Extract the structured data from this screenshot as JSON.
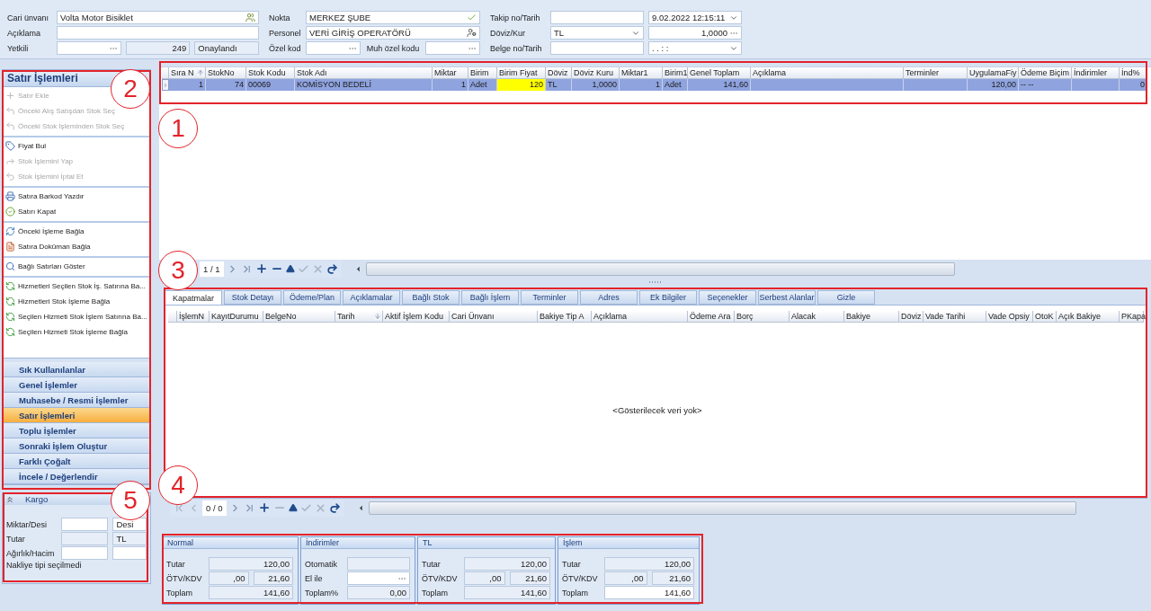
{
  "header": {
    "columns": [
      {
        "rows": [
          {
            "label": "Cari ünvanı",
            "fields": [
              {
                "kind": "people",
                "value": "Volta Motor Bisiklet",
                "editable": true
              }
            ]
          },
          {
            "label": "Açıklama",
            "fields": [
              {
                "editable": true
              }
            ]
          },
          {
            "label": "Yetkili",
            "fields": [
              {
                "kind": "lookup",
                "editable": true
              },
              {
                "kind": "number",
                "value": "249",
                "editable": false
              },
              {
                "value": "Onaylandı",
                "editable": false
              }
            ]
          }
        ]
      },
      {
        "rows": [
          {
            "label": "Nokta",
            "fields": [
              {
                "kind": "check",
                "value": "MERKEZ ŞUBE",
                "editable": true
              }
            ]
          },
          {
            "label": "Personel",
            "fields": [
              {
                "kind": "user",
                "value": "VERİ GİRİŞ OPERATÖRÜ",
                "editable": true
              }
            ]
          },
          {
            "label": "Özel kod",
            "fields": [
              {
                "kind": "lookup",
                "editable": true
              },
              {
                "kind": "label",
                "value": "Muh özel kodu"
              },
              {
                "kind": "lookup",
                "editable": true
              }
            ]
          }
        ]
      },
      {
        "rows": [
          {
            "label": "Takip no/Tarih",
            "fields": [
              {
                "editable": true
              },
              {
                "kind": "dropdown",
                "value": "9.02.2022 12:15:11",
                "editable": true
              }
            ]
          },
          {
            "label": "Döviz/Kur",
            "fields": [
              {
                "kind": "dropdown",
                "value": "TL",
                "editable": true
              },
              {
                "kind": "number-lookup",
                "value": "1,0000",
                "editable": true
              }
            ]
          },
          {
            "label": "Belge no/Tarih",
            "fields": [
              {
                "editable": true
              },
              {
                "kind": "dropdown",
                "value": ". .     : :",
                "editable": true
              }
            ]
          }
        ]
      }
    ]
  },
  "sidebar": {
    "title": "Satır İşlemleri",
    "groups": [
      {
        "items": [
          {
            "label": "Satır Ekle",
            "disabled": true
          },
          {
            "label": "Önceki Alış Satışdan Stok Seç",
            "disabled": true
          },
          {
            "label": "Önceki Stok İşleminden Stok Seç",
            "disabled": true
          }
        ]
      },
      {
        "items": [
          {
            "label": "Fiyat Bul",
            "disabled": false
          },
          {
            "label": "Stok İşlemini Yap",
            "disabled": true
          },
          {
            "label": "Stok İşlemini İptal Et",
            "disabled": true
          }
        ]
      },
      {
        "items": [
          {
            "label": "Satıra Barkod Yazdır",
            "disabled": false
          },
          {
            "label": "Satırı Kapat",
            "disabled": false
          }
        ]
      },
      {
        "items": [
          {
            "label": "Önceki İşleme Bağla",
            "disabled": false
          },
          {
            "label": "Satıra Doküman Bağla",
            "disabled": false
          }
        ]
      },
      {
        "items": [
          {
            "label": "Bağlı Satırları Göster",
            "disabled": false
          }
        ]
      },
      {
        "items": [
          {
            "label": "Hizmetleri Seçilen Stok İş. Satırına Ba...",
            "disabled": false
          },
          {
            "label": "Hizmetleri Stok İşleme Bağla",
            "disabled": false
          },
          {
            "label": "Seçilen Hizmeti Stok İşlem Satırına Ba...",
            "disabled": false
          },
          {
            "label": "Seçilen Hizmeti Stok İşleme Bağla",
            "disabled": false
          }
        ]
      }
    ],
    "sections": [
      {
        "label": "Sık Kullanılanlar",
        "selected": false
      },
      {
        "label": "Genel İşlemler",
        "selected": false
      },
      {
        "label": "Muhasebe / Resmi İşlemler",
        "selected": false
      },
      {
        "label": "Satır İşlemleri",
        "selected": true
      },
      {
        "label": "Toplu İşlemler",
        "selected": false
      },
      {
        "label": "Sonraki İşlem Oluştur",
        "selected": false
      },
      {
        "label": "Farklı Çoğalt",
        "selected": false
      },
      {
        "label": "İncele / Değerlendir",
        "selected": false
      }
    ]
  },
  "kargo": {
    "title": "Kargo",
    "rows": [
      {
        "label": "Miktar/Desi",
        "fields": [
          {
            "editable": true
          },
          {
            "value": "Desi",
            "editable": true
          }
        ]
      },
      {
        "label": "Tutar",
        "fields": [
          {
            "editable": false
          },
          {
            "value": "TL",
            "editable": false
          }
        ]
      },
      {
        "label": "Ağırlık/Hacim",
        "fields": [
          {
            "editable": true
          },
          {
            "editable": true
          }
        ]
      }
    ],
    "note": "Nakliye tipi seçilmedi"
  },
  "table": {
    "columns": [
      {
        "label": "Sıra N",
        "sorted": true,
        "descending": false
      },
      {
        "label": "StokNo",
        "sorted": false
      },
      {
        "label": "Stok Kodu",
        "sorted": false
      },
      {
        "label": "Stok Adı",
        "sorted": false
      },
      {
        "label": "Miktar",
        "sorted": false
      },
      {
        "label": "Birim",
        "sorted": false
      },
      {
        "label": "Birim Fiyat",
        "sorted": false
      },
      {
        "label": "Döviz",
        "sorted": false
      },
      {
        "label": "Döviz Kuru",
        "sorted": false
      },
      {
        "label": "Miktar1",
        "sorted": false
      },
      {
        "label": "Birim1",
        "sorted": false
      },
      {
        "label": "Genel Toplam",
        "sorted": false
      },
      {
        "label": "Açıklama",
        "sorted": false
      },
      {
        "label": "Terminler",
        "sorted": false
      },
      {
        "label": "UygulamaFiy",
        "sorted": false
      },
      {
        "label": "Ödeme Biçim",
        "sorted": false
      },
      {
        "label": "İndirimler",
        "sorted": false
      },
      {
        "label": "İnd%",
        "sorted": false
      }
    ],
    "rows": [
      {
        "selected": true,
        "cells": [
          {
            "value": "1",
            "focused": false
          },
          {
            "value": "74",
            "focused": false
          },
          {
            "value": "00069",
            "focused": false
          },
          {
            "value": "KOMİSYON BEDELİ",
            "focused": false
          },
          {
            "value": "1",
            "focused": false
          },
          {
            "value": "Adet",
            "focused": false
          },
          {
            "value": "120",
            "focused": true
          },
          {
            "value": "TL",
            "focused": false
          },
          {
            "value": "1,0000",
            "focused": false
          },
          {
            "value": "1",
            "focused": false
          },
          {
            "value": "Adet",
            "focused": false
          },
          {
            "value": "141,60",
            "focused": false
          },
          {
            "focused": false
          },
          {
            "focused": false
          },
          {
            "value": "120,00",
            "focused": false
          },
          {
            "value": "-- --",
            "focused": false
          },
          {
            "focused": false
          },
          {
            "value": "0",
            "focused": false
          }
        ]
      }
    ],
    "navigator": {
      "position": "1 / 1",
      "show_first_prev": false
    }
  },
  "detail": {
    "tabs": [
      {
        "label": "Kapatmalar",
        "selected": true
      },
      {
        "label": "Stok Detayı",
        "selected": false
      },
      {
        "label": "Ödeme/Plan",
        "selected": false
      },
      {
        "label": "Açıklamalar",
        "selected": false
      },
      {
        "label": "Bağlı Stok",
        "selected": false
      },
      {
        "label": "Bağlı İşlem",
        "selected": false
      },
      {
        "label": "Terminler",
        "selected": false
      },
      {
        "label": "Adres",
        "selected": false
      },
      {
        "label": "Ek Bilgiler",
        "selected": false
      },
      {
        "label": "Seçenekler",
        "selected": false
      },
      {
        "label": "Serbest Alanlar",
        "selected": false
      },
      {
        "label": "Gizle",
        "selected": false
      }
    ],
    "columns": [
      {
        "label": "İşlemN",
        "sorted": false
      },
      {
        "label": "KayıtDurumu",
        "sorted": false
      },
      {
        "label": "BelgeNo",
        "sorted": false
      },
      {
        "label": "Tarih",
        "sorted": true,
        "descending": true
      },
      {
        "label": "Aktif İşlem Kodu",
        "sorted": false
      },
      {
        "label": "Cari Ünvanı",
        "sorted": false
      },
      {
        "label": "Bakiye Tip A",
        "sorted": false
      },
      {
        "label": "Açıklama",
        "sorted": false
      },
      {
        "label": "Ödeme Ara",
        "sorted": false
      },
      {
        "label": "Borç",
        "sorted": false
      },
      {
        "label": "Alacak",
        "sorted": false
      },
      {
        "label": "Bakiye",
        "sorted": false
      },
      {
        "label": "Döviz",
        "sorted": false
      },
      {
        "label": "Vade Tarihi",
        "sorted": false
      },
      {
        "label": "Vade Opsiy",
        "sorted": false
      },
      {
        "label": "OtoK",
        "sorted": false
      },
      {
        "label": "Açık Bakiye",
        "sorted": false
      },
      {
        "label": "PKapa",
        "sorted": false
      }
    ],
    "empty_message": "<Gösterilecek veri yok>",
    "navigator": {
      "position": "0 / 0",
      "show_first_prev": true
    }
  },
  "totals": [
    {
      "title": "Normal",
      "rows": [
        {
          "label": "Tutar",
          "fields": [
            {
              "kind": "number",
              "value": "120,00",
              "editable": false
            }
          ]
        },
        {
          "label": "ÖTV/KDV",
          "fields": [
            {
              "kind": "number",
              "value": ",00",
              "editable": false
            },
            {
              "kind": "number",
              "value": "21,60",
              "editable": false
            }
          ]
        },
        {
          "label": "Toplam",
          "fields": [
            {
              "kind": "number",
              "value": "141,60",
              "editable": false
            }
          ]
        }
      ]
    },
    {
      "title": "İndirimler",
      "rows": [
        {
          "label": "Otomatik",
          "fields": [
            {
              "editable": false
            }
          ]
        },
        {
          "label": "El ile",
          "fields": [
            {
              "kind": "lookup",
              "editable": true
            }
          ]
        },
        {
          "label": "Toplam%",
          "fields": [
            {
              "kind": "number",
              "value": "0,00",
              "editable": false
            }
          ]
        }
      ]
    },
    {
      "title": "TL",
      "rows": [
        {
          "label": "Tutar",
          "fields": [
            {
              "kind": "number",
              "value": "120,00",
              "editable": false
            }
          ]
        },
        {
          "label": "ÖTV/KDV",
          "fields": [
            {
              "kind": "number",
              "value": ",00",
              "editable": false
            },
            {
              "kind": "number",
              "value": "21,60",
              "editable": false
            }
          ]
        },
        {
          "label": "Toplam",
          "fields": [
            {
              "kind": "number",
              "value": "141,60",
              "editable": false
            }
          ]
        }
      ]
    },
    {
      "title": "İşlem",
      "rows": [
        {
          "label": "Tutar",
          "fields": [
            {
              "kind": "number",
              "value": "120,00",
              "editable": false
            }
          ]
        },
        {
          "label": "ÖTV/KDV",
          "fields": [
            {
              "kind": "number",
              "value": ",00",
              "editable": false
            },
            {
              "kind": "number",
              "value": "21,60",
              "editable": false
            }
          ]
        },
        {
          "label": "Toplam",
          "fields": [
            {
              "kind": "number",
              "value": "141,60",
              "editable": true
            }
          ]
        }
      ]
    }
  ],
  "annotations": [
    {
      "label": "1"
    },
    {
      "label": "2"
    },
    {
      "label": "3"
    },
    {
      "label": "4"
    },
    {
      "label": "5"
    }
  ]
}
